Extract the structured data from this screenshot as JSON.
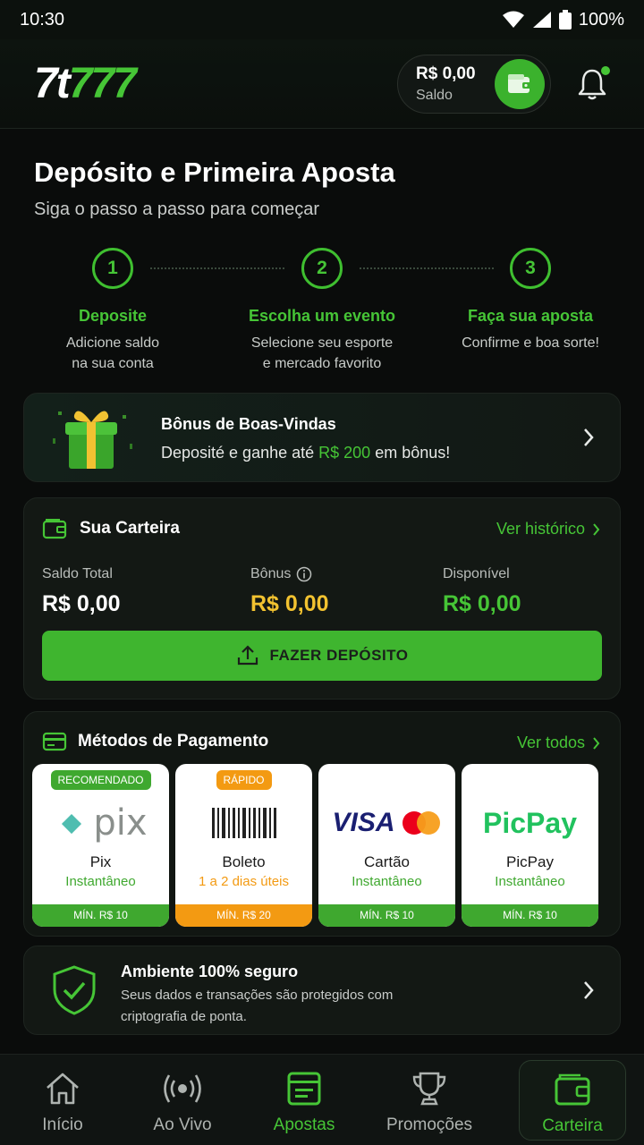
{
  "status_bar": {
    "time": "10:30",
    "battery": "100%"
  },
  "header": {
    "logo_a": "7t",
    "logo_b": "777",
    "balance_amount": "R$ 0,00",
    "balance_label": "Saldo"
  },
  "page": {
    "title": "Depósito e Primeira Aposta",
    "subtitle": "Siga o passo a passo para começar"
  },
  "steps": [
    {
      "number": "1",
      "title": "Deposite",
      "desc1": "Adicione saldo",
      "desc2": "na sua conta"
    },
    {
      "number": "2",
      "title": "Escolha um evento",
      "desc1": "Selecione seu esporte",
      "desc2": "e mercado favorito"
    },
    {
      "number": "3",
      "title": "Faça sua aposta",
      "desc1": "Confirme e boa sorte!",
      "desc2": ""
    }
  ],
  "bonus": {
    "title": "Bônus de Boas-Vindas",
    "desc_pre": "Deposité e ganhe até ",
    "desc_highlight": "R$ 200",
    "desc_post": " em bônus!"
  },
  "wallet": {
    "title": "Sua Carteira",
    "history_link": "Ver histórico",
    "total_label": "Saldo Total",
    "total_value": "R$ 0,00",
    "bonus_label": "Bônus",
    "bonus_value": "R$ 0,00",
    "available_label": "Disponível",
    "available_value": "R$ 0,00",
    "deposit_button": "FAZER DEPÓSITO",
    "colors": {
      "bonus": "#f2c230",
      "available": "#46c536"
    }
  },
  "payment": {
    "title": "Métodos de Pagamento",
    "see_all": "Ver todos",
    "methods": [
      {
        "badge": "RECOMENDADO",
        "logo_text": "pix",
        "name": "Pix",
        "sub": "Instantâneo",
        "min": "MÍN. R$ 10",
        "color": "#3fa82f"
      },
      {
        "badge": "RÁPIDO",
        "logo_text": "",
        "name": "Boleto",
        "sub": "1 a 2 dias úteis",
        "min": "MÍN. R$ 20",
        "color": "#f39a12"
      },
      {
        "badge": "",
        "logo_text": "VISA",
        "name": "Cartão",
        "sub": "Instantâneo",
        "min": "MÍN. R$ 10",
        "color": "#3fa82f"
      },
      {
        "badge": "",
        "logo_text": "PicPay",
        "name": "PicPay",
        "sub": "Instantâneo",
        "min": "MÍN. R$ 10",
        "color": "#3fa82f"
      }
    ]
  },
  "security": {
    "title": "Ambiente 100% seguro",
    "desc": "Seus dados e transações são protegidos com criptografia de ponta."
  },
  "bottom_nav": [
    {
      "label": "Início",
      "icon": "home-icon"
    },
    {
      "label": "Ao Vivo",
      "icon": "live-icon"
    },
    {
      "label": "Apostas",
      "icon": "bets-icon"
    },
    {
      "label": "Promoções",
      "icon": "trophy-icon"
    },
    {
      "label": "Carteira",
      "icon": "wallet-icon"
    }
  ]
}
